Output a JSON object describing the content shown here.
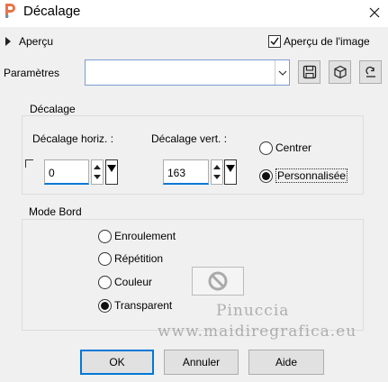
{
  "window": {
    "title": "Décalage"
  },
  "preview": {
    "toggle_label": "Aperçu",
    "checkbox_label": "Aperçu de l'image",
    "checked": true
  },
  "presets": {
    "label": "Paramètres",
    "value": ""
  },
  "offset_group": {
    "title": "Décalage",
    "horiz_label": "Décalage horiz. :",
    "horiz_value": "0",
    "vert_label": "Décalage vert. :",
    "vert_value": "163",
    "options": [
      {
        "label": "Centrer",
        "selected": false
      },
      {
        "label": "Personnalisée",
        "selected": true
      }
    ]
  },
  "edge_group": {
    "title": "Mode Bord",
    "options": [
      {
        "label": "Enroulement",
        "selected": false
      },
      {
        "label": "Répétition",
        "selected": false
      },
      {
        "label": "Couleur",
        "selected": false
      },
      {
        "label": "Transparent",
        "selected": true
      }
    ]
  },
  "watermark": {
    "line1": "Pinuccia",
    "line2": "www.maidiregrafica.eu"
  },
  "buttons": {
    "ok": "OK",
    "cancel": "Annuler",
    "help": "Aide"
  },
  "colors": {
    "accent": "#0078d7",
    "app_icon": "#e8734a"
  }
}
